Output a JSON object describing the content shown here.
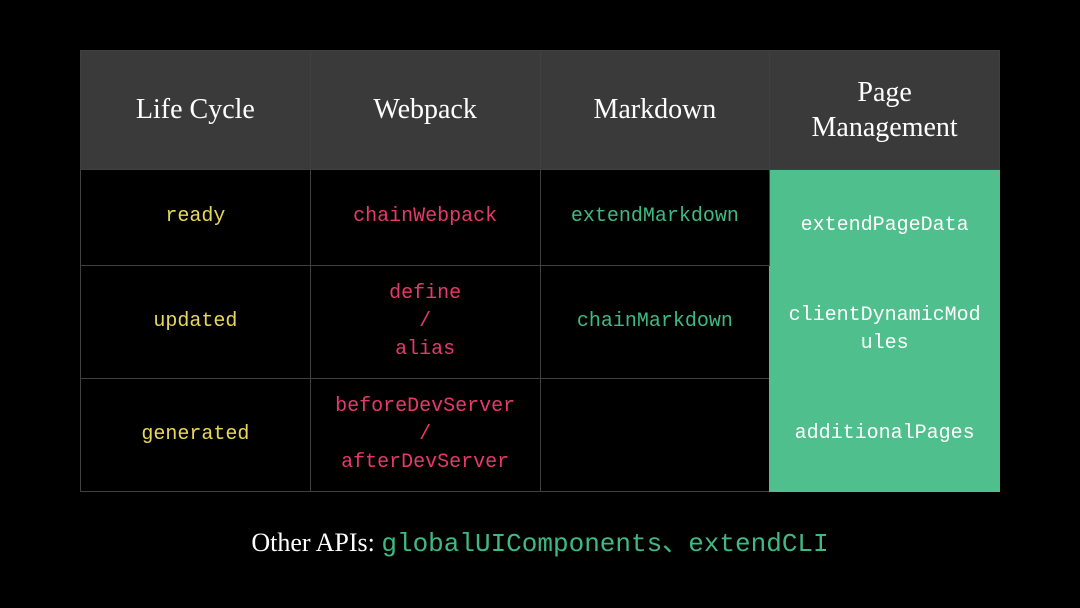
{
  "headers": {
    "lifecycle": "Life Cycle",
    "webpack": "Webpack",
    "markdown": "Markdown",
    "page": "Page\nManagement"
  },
  "rows": [
    {
      "lifecycle": "ready",
      "webpack": "chainWebpack",
      "markdown": "extendMarkdown"
    },
    {
      "lifecycle": "updated",
      "webpack": "define\n/\nalias",
      "markdown": "chainMarkdown"
    },
    {
      "lifecycle": "generated",
      "webpack": "beforeDevServer\n/\nafterDevServer",
      "markdown": ""
    }
  ],
  "pageManagement": {
    "items": [
      "extendPageData",
      "clientDynamicMod\nules",
      "additionalPages"
    ]
  },
  "footer": {
    "label": "Other APIs: ",
    "apis": "globalUIComponents、extendCLI"
  }
}
